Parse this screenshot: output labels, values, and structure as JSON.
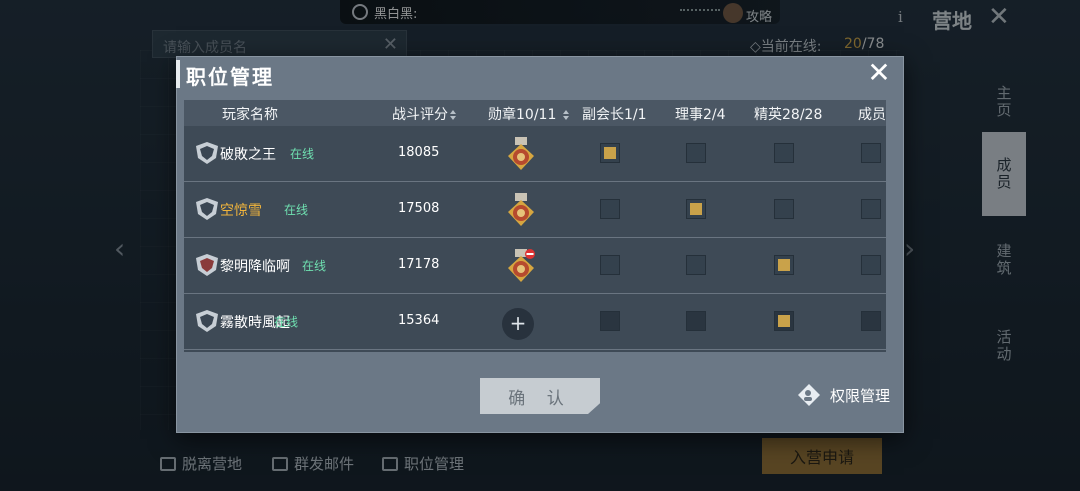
{
  "top": {
    "chat_name": "黑白黑:",
    "guide_label": "攻略",
    "info_symbol": "i",
    "camp_title": "营地",
    "close_symbol": "✕"
  },
  "background": {
    "search_placeholder": "请输入成员名",
    "online_label": "◇当前在线:",
    "online_current": "20",
    "online_total": "/78",
    "right_tabs": [
      "主页",
      "成员",
      "建筑",
      "活动"
    ],
    "active_tab": "成员",
    "bottom_actions": {
      "leave": "脱离营地",
      "mass_mail": "群发邮件",
      "positions": "职位管理"
    },
    "apply_button": "入营申请"
  },
  "modal": {
    "title": "职位管理",
    "close_symbol": "✕",
    "headers": {
      "player_name": "玩家名称",
      "combat_score": "战斗评分",
      "medal": "勋章10/11",
      "vice_leader": "副会长1/1",
      "director": "理事2/4",
      "elite": "精英28/28",
      "member": "成员"
    },
    "rows": [
      {
        "name": "破敗之王",
        "status": "在线",
        "score": "18085",
        "medal": "gold",
        "vice": true,
        "director": false,
        "elite": false,
        "member": false
      },
      {
        "name": "空惊雪",
        "status": "在线",
        "score": "17508",
        "medal": "gold",
        "vice": false,
        "director": true,
        "elite": false,
        "member": false
      },
      {
        "name": "黎明降临啊",
        "status": "在线",
        "score": "17178",
        "medal": "gold-remove",
        "vice": false,
        "director": false,
        "elite": true,
        "member": false
      },
      {
        "name": "霧散時風起",
        "status": "在线",
        "score": "15364",
        "medal": "add",
        "vice": false,
        "director": false,
        "elite": true,
        "member": false
      }
    ],
    "confirm_button": "确 认",
    "permission_label": "权限管理"
  },
  "colors": {
    "accent_gold": "#e1b24a",
    "online_green": "#6fe0b0",
    "checked_fill": "#c9a24a",
    "apply_orange": "#e3a33b"
  }
}
